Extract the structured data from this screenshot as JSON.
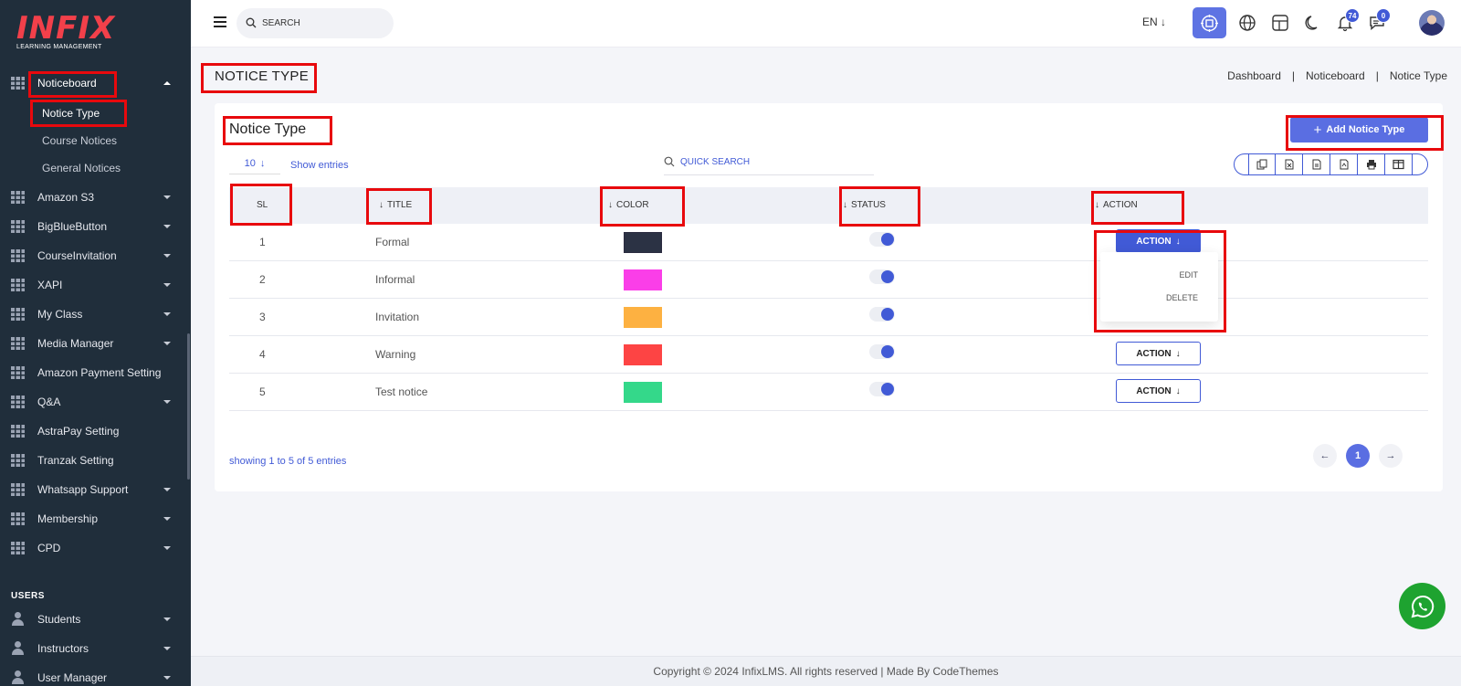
{
  "brand": {
    "name": "INFIX",
    "tagline": "LEARNING MANAGEMENT"
  },
  "sidebar": {
    "items": [
      {
        "label": "Noticeboard",
        "expanded": true
      },
      {
        "label": "Amazon S3"
      },
      {
        "label": "BigBlueButton"
      },
      {
        "label": "CourseInvitation"
      },
      {
        "label": "XAPI"
      },
      {
        "label": "My Class"
      },
      {
        "label": "Media Manager"
      },
      {
        "label": "Amazon Payment Setting"
      },
      {
        "label": "Q&A"
      },
      {
        "label": "AstraPay Setting"
      },
      {
        "label": "Tranzak Setting"
      },
      {
        "label": "Whatsapp Support"
      },
      {
        "label": "Membership"
      },
      {
        "label": "CPD"
      }
    ],
    "noticeboard_children": [
      "Notice Type",
      "Course Notices",
      "General Notices"
    ],
    "section_users": "USERS",
    "user_items": [
      "Students",
      "Instructors",
      "User Manager"
    ]
  },
  "topbar": {
    "search_placeholder": "SEARCH",
    "language": "EN",
    "notifications_count": "74",
    "messages_count": "0",
    "icons": [
      "menu-icon",
      "search-icon",
      "cpu-icon",
      "globe-icon",
      "layout-icon",
      "moon-icon",
      "bell-icon",
      "chat-icon"
    ]
  },
  "page": {
    "title": "NOTICE TYPE",
    "breadcrumb": [
      "Dashboard",
      "Noticeboard",
      "Notice Type"
    ]
  },
  "card": {
    "title": "Notice Type",
    "add_button": "Add Notice Type",
    "entries_value": "10",
    "entries_label": "Show entries",
    "quick_search_placeholder": "QUICK SEARCH",
    "export_icons": [
      "copy-icon",
      "excel-icon",
      "csv-icon",
      "pdf-icon",
      "print-icon",
      "columns-icon"
    ]
  },
  "table": {
    "headers": [
      "SL",
      "TITLE",
      "COLOR",
      "STATUS",
      "ACTION"
    ],
    "rows": [
      {
        "sl": "1",
        "title": "Formal",
        "color": "#2b3244",
        "status": true,
        "action": "ACTION"
      },
      {
        "sl": "2",
        "title": "Informal",
        "color": "#fa3ee8",
        "status": true,
        "action": "ACTION"
      },
      {
        "sl": "3",
        "title": "Invitation",
        "color": "#fdb141",
        "status": true,
        "action": "ACTION"
      },
      {
        "sl": "4",
        "title": "Warning",
        "color": "#fd4444",
        "status": true,
        "action": "ACTION"
      },
      {
        "sl": "5",
        "title": "Test notice",
        "color": "#34d88a",
        "status": true,
        "action": "ACTION"
      }
    ],
    "dropdown_items": [
      "EDIT",
      "DELETE"
    ],
    "showing_text": "showing 1 to 5 of 5 entries",
    "current_page": "1"
  },
  "footer": {
    "text": "Copyright © 2024 InfixLMS. All rights reserved | Made By CodeThemes"
  },
  "colors": {
    "sidebar_bg": "#202e3b",
    "accent": "#415ad6",
    "brand": "#f2404a",
    "whatsapp": "#1ea330"
  }
}
